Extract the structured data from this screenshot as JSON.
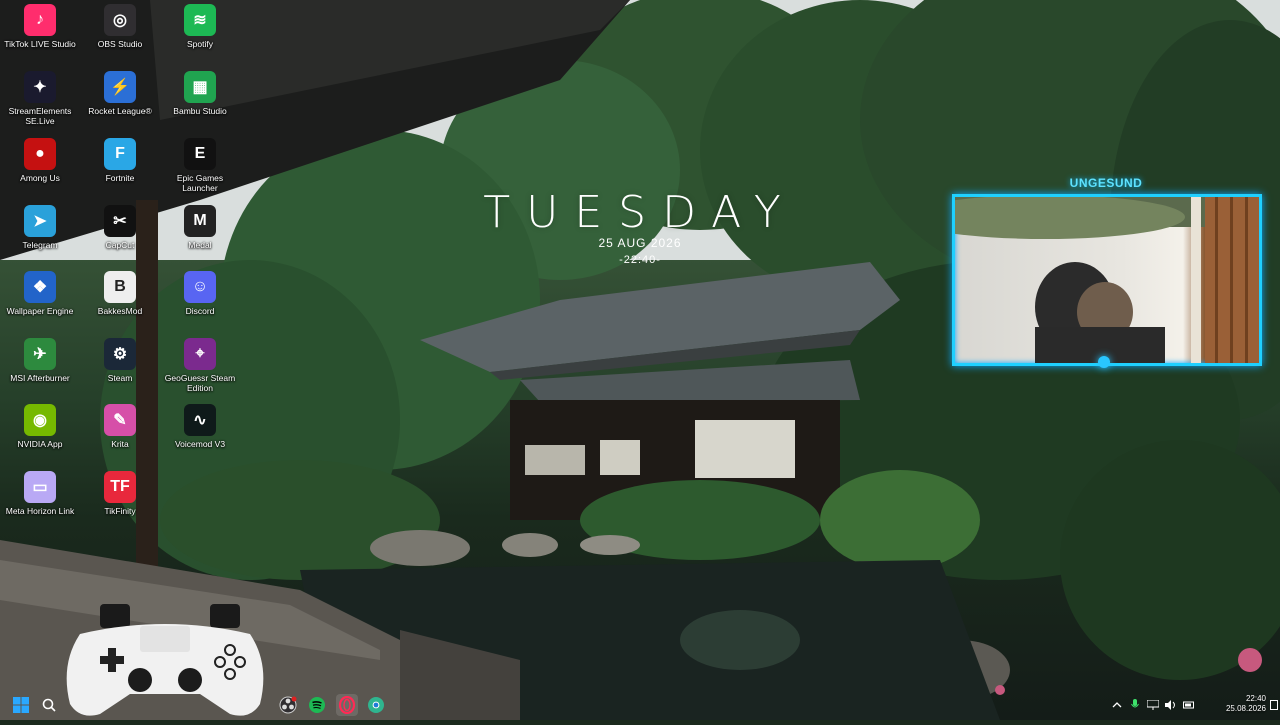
{
  "desktop": {
    "icons": [
      {
        "label": "TikTok LIVE Studio",
        "name": "tiktok-live-studio",
        "icon": "tiktok-icon",
        "color": "#ff2d6d"
      },
      {
        "label": "OBS Studio",
        "name": "obs-studio",
        "icon": "obs-icon",
        "color": "#302e31"
      },
      {
        "label": "Spotify",
        "name": "spotify",
        "icon": "spotify-icon",
        "color": "#1db954"
      },
      {
        "label": "StreamElements SE.Live",
        "name": "streamelements",
        "icon": "streamelements-icon",
        "color": "#1a1a2e"
      },
      {
        "label": "Rocket League®",
        "name": "rocket-league",
        "icon": "rocket-league-icon",
        "color": "#2b6fd6"
      },
      {
        "label": "Bambu Studio",
        "name": "bambu-studio",
        "icon": "bambu-icon",
        "color": "#20a450"
      },
      {
        "label": "Among Us",
        "name": "among-us",
        "icon": "among-us-icon",
        "color": "#c51111"
      },
      {
        "label": "Fortnite",
        "name": "fortnite",
        "icon": "fortnite-icon",
        "color": "#2aa7e6"
      },
      {
        "label": "Epic Games Launcher",
        "name": "epic-games-launcher",
        "icon": "epic-games-icon",
        "color": "#111111"
      },
      {
        "label": "Telegram",
        "name": "telegram",
        "icon": "telegram-icon",
        "color": "#2aa1da"
      },
      {
        "label": "CapCut",
        "name": "capcut",
        "icon": "capcut-icon",
        "color": "#111111"
      },
      {
        "label": "Medal",
        "name": "medal",
        "icon": "medal-icon",
        "color": "#222222"
      },
      {
        "label": "Wallpaper Engine",
        "name": "wallpaper-engine",
        "icon": "wallpaper-engine-icon",
        "color": "#2264c9"
      },
      {
        "label": "BakkesMod",
        "name": "bakkesmod",
        "icon": "bakkesmod-icon",
        "color": "#eeeeee"
      },
      {
        "label": "Discord",
        "name": "discord",
        "icon": "discord-icon",
        "color": "#5865f2"
      },
      {
        "label": "MSI Afterburner",
        "name": "msi-afterburner",
        "icon": "msi-afterburner-icon",
        "color": "#2d8a3e"
      },
      {
        "label": "Steam",
        "name": "steam",
        "icon": "steam-icon",
        "color": "#1b2838"
      },
      {
        "label": "GeoGuessr Steam Edition",
        "name": "geoguessr",
        "icon": "geoguessr-icon",
        "color": "#7b2a8e"
      },
      {
        "label": "NVIDIA App",
        "name": "nvidia-app",
        "icon": "nvidia-icon",
        "color": "#76b900"
      },
      {
        "label": "Krita",
        "name": "krita",
        "icon": "krita-icon",
        "color": "#d64fa8"
      },
      {
        "label": "Voicemod V3",
        "name": "voicemod",
        "icon": "voicemod-icon",
        "color": "#0f1a1a"
      },
      {
        "label": "Meta Horizon Link",
        "name": "meta-horizon-link",
        "icon": "meta-horizon-icon",
        "color": "#b9a9f5"
      },
      {
        "label": "TikFinity",
        "name": "tikfinity",
        "icon": "tikfinity-icon",
        "color": "#e8283c"
      }
    ]
  },
  "widget": {
    "day": "TUESDAY",
    "date": "25 AUG 2026",
    "time": "-22:40-"
  },
  "webcam": {
    "name": "UNGESUND",
    "accent": "#1fd0ff"
  },
  "taskbar": {
    "start_icon": "windows-start-icon",
    "search_icon": "search-icon",
    "pinned": [
      "obs-icon",
      "spotify-icon",
      "opera-gx-icon",
      "chrome-like-icon"
    ],
    "tray": {
      "time": "22:40",
      "date": "25.08.2026"
    }
  }
}
